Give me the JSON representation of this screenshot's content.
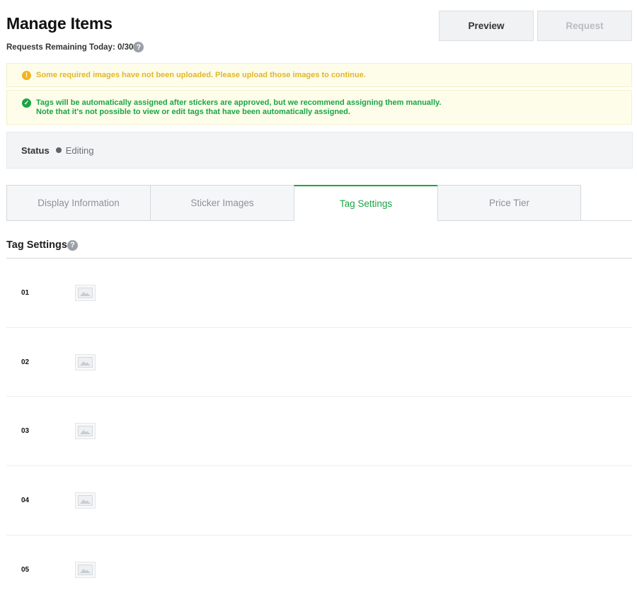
{
  "page": {
    "title": "Manage Items",
    "requests_remaining": "Requests Remaining Today: 0/30"
  },
  "toolbar": {
    "preview_label": "Preview",
    "request_label": "Request"
  },
  "alerts": {
    "warning_text": "Some required images have not been uploaded. Please upload those images to continue.",
    "info_line1": "Tags will be automatically assigned after stickers are approved, but we recommend assigning them manually.",
    "info_line2": "Note that it's not possible to view or edit tags that have been automatically assigned."
  },
  "status": {
    "label": "Status",
    "value": "Editing"
  },
  "tabs": [
    {
      "label": "Display Information",
      "active": false
    },
    {
      "label": "Sticker Images",
      "active": false
    },
    {
      "label": "Tag Settings",
      "active": true
    },
    {
      "label": "Price Tier",
      "active": false
    }
  ],
  "section": {
    "title": "Tag Settings"
  },
  "stickers": [
    {
      "number": "01"
    },
    {
      "number": "02"
    },
    {
      "number": "03"
    },
    {
      "number": "04"
    },
    {
      "number": "05"
    }
  ],
  "icons": {
    "help": "question-circle-icon",
    "warning": "exclamation-circle-icon",
    "success": "check-circle-icon",
    "thumbnail": "image-placeholder-icon"
  },
  "colors": {
    "accent_green": "#1aa545",
    "warning_yellow": "#e0b62a",
    "status_dot": "#606368"
  }
}
